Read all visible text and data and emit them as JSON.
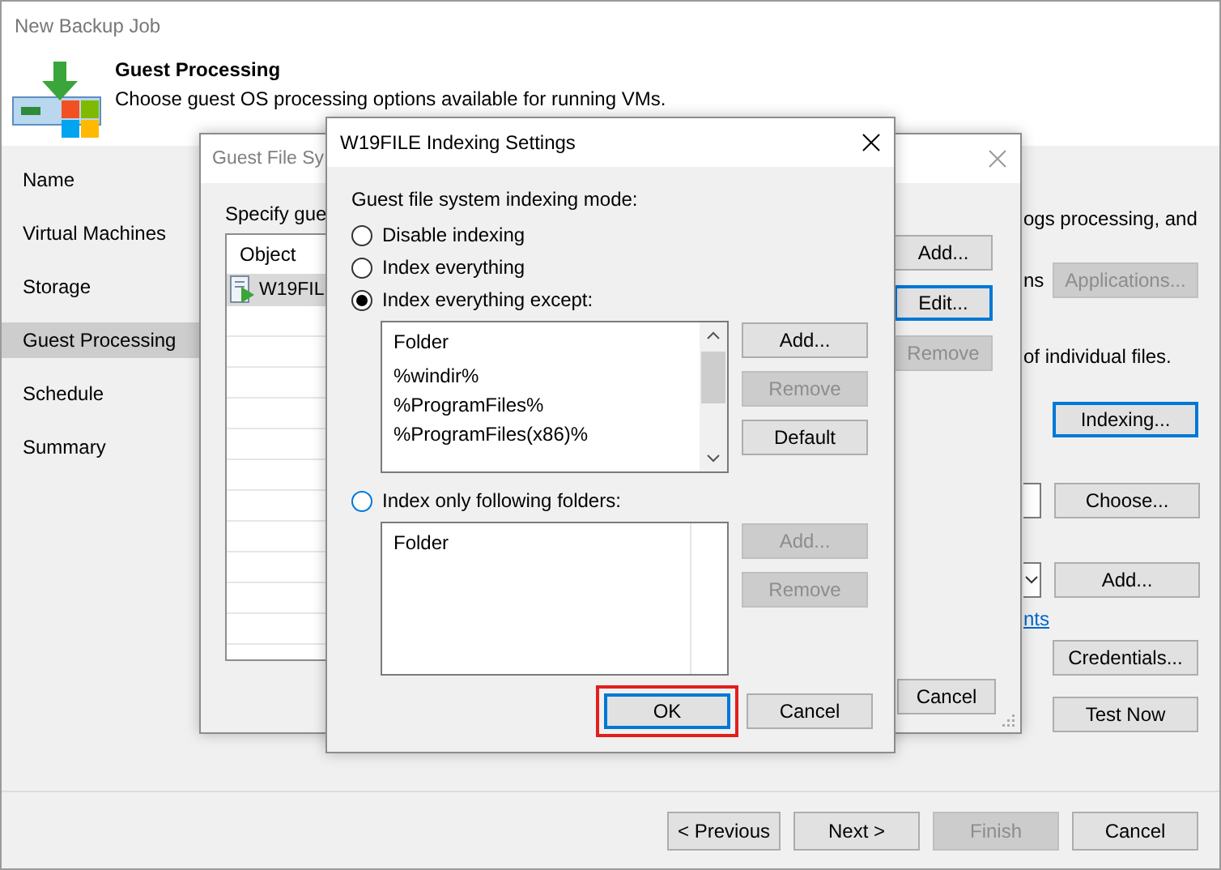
{
  "window": {
    "title": "New Backup Job"
  },
  "header": {
    "title": "Guest Processing",
    "subtitle": "Choose guest OS processing options available for running VMs."
  },
  "sidebar": {
    "items": [
      {
        "label": "Name",
        "selected": false
      },
      {
        "label": "Virtual Machines",
        "selected": false
      },
      {
        "label": "Storage",
        "selected": false
      },
      {
        "label": "Guest Processing",
        "selected": true
      },
      {
        "label": "Schedule",
        "selected": false
      },
      {
        "label": "Summary",
        "selected": false
      }
    ]
  },
  "main_panel": {
    "rows": [
      {
        "kind": "text",
        "text": "ogs processing, and"
      },
      {
        "kind": "text-button",
        "text": "ns",
        "button": {
          "label": "Applications...",
          "disabled": true,
          "focused": false
        }
      },
      {
        "kind": "text",
        "text": "of individual files."
      },
      {
        "kind": "button",
        "button": {
          "label": "Indexing...",
          "disabled": false,
          "focused": true
        }
      },
      {
        "kind": "field-button",
        "button": {
          "label": "Choose...",
          "disabled": false,
          "focused": false
        }
      },
      {
        "kind": "dropdown-button",
        "button": {
          "label": "Add...",
          "disabled": false,
          "focused": false
        }
      },
      {
        "kind": "link",
        "text": "nts"
      },
      {
        "kind": "button",
        "button": {
          "label": "Credentials...",
          "disabled": false,
          "focused": false
        }
      },
      {
        "kind": "button",
        "button": {
          "label": "Test Now",
          "disabled": false,
          "focused": false
        }
      }
    ]
  },
  "footer": {
    "buttons": [
      {
        "label": "< Previous",
        "disabled": false
      },
      {
        "label": "Next >",
        "disabled": false
      },
      {
        "label": "Finish",
        "disabled": true
      },
      {
        "label": "Cancel",
        "disabled": false
      }
    ]
  },
  "guest_file_dialog": {
    "title": "Guest File Sy",
    "prompt": "Specify gue",
    "table": {
      "columns": [
        "Object"
      ],
      "rows": [
        {
          "object": "W19FIL",
          "selected": true
        }
      ]
    },
    "buttons": [
      {
        "label": "Add...",
        "disabled": false,
        "focused": false
      },
      {
        "label": "Edit...",
        "disabled": false,
        "focused": true
      },
      {
        "label": "Remove",
        "disabled": true,
        "focused": false
      }
    ],
    "cancel": "Cancel"
  },
  "indexing_dialog": {
    "title": "W19FILE Indexing Settings",
    "label": "Guest file system indexing mode:",
    "modes": [
      {
        "label": "Disable indexing",
        "selected": false
      },
      {
        "label": "Index everything",
        "selected": false
      },
      {
        "label": "Index everything except:",
        "selected": true
      },
      {
        "label": "Index only following folders:",
        "selected": false
      }
    ],
    "exclude_list": {
      "column": "Folder",
      "items": [
        "%windir%",
        "%ProgramFiles%",
        "%ProgramFiles(x86)%"
      ]
    },
    "exclude_buttons": [
      {
        "label": "Add...",
        "disabled": false
      },
      {
        "label": "Remove",
        "disabled": true
      },
      {
        "label": "Default",
        "disabled": false
      }
    ],
    "include_list": {
      "column": "Folder"
    },
    "include_buttons": [
      {
        "label": "Add...",
        "disabled": true
      },
      {
        "label": "Remove",
        "disabled": true
      }
    ],
    "ok": {
      "label": "OK",
      "focused": true,
      "highlighted": true
    },
    "cancel": "Cancel"
  }
}
